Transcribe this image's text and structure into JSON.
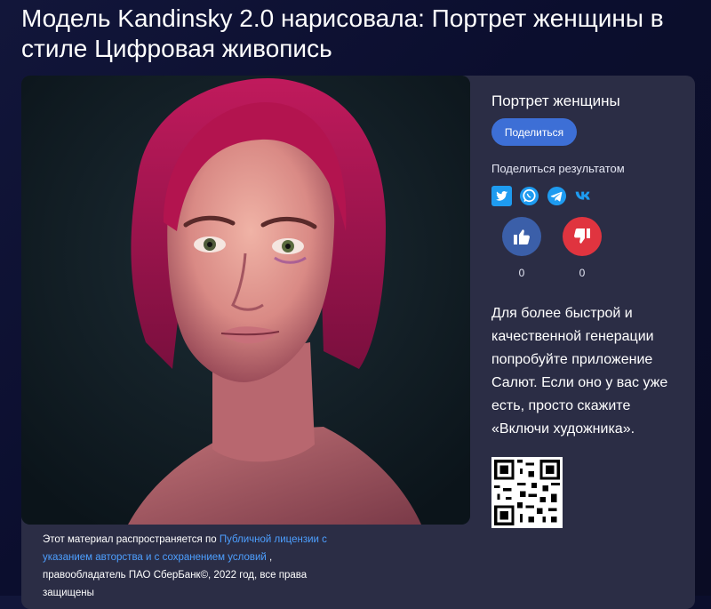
{
  "page": {
    "title": "Модель Kandinsky 2.0 нарисовала: Портрет женщины в стиле Цифровая живопись"
  },
  "result": {
    "prompt": "Портрет женщины",
    "share_button": "Поделиться",
    "share_result_label": "Поделиться результатом",
    "socials": [
      "twitter-icon",
      "whatsapp-icon",
      "telegram-icon",
      "vk-icon"
    ],
    "likes": "0",
    "dislikes": "0",
    "promo_text": "Для более быстрой и качественной генерации попробуйте приложение Салют. Если оно у вас уже есть, просто скажите «Включи художника»."
  },
  "license": {
    "prefix": "Этот материал распространяется по ",
    "link": "Публичной лицензии с указанием авторства и с сохранением условий",
    "suffix": " , правообладатель ПАО СберБанк©, 2022 год, все права защищены"
  },
  "colors": {
    "accent": "#3d6fd6",
    "like": "#3b5fa9",
    "dislike": "#e0343f",
    "link": "#4d9fff",
    "card": "#2b2d45"
  }
}
